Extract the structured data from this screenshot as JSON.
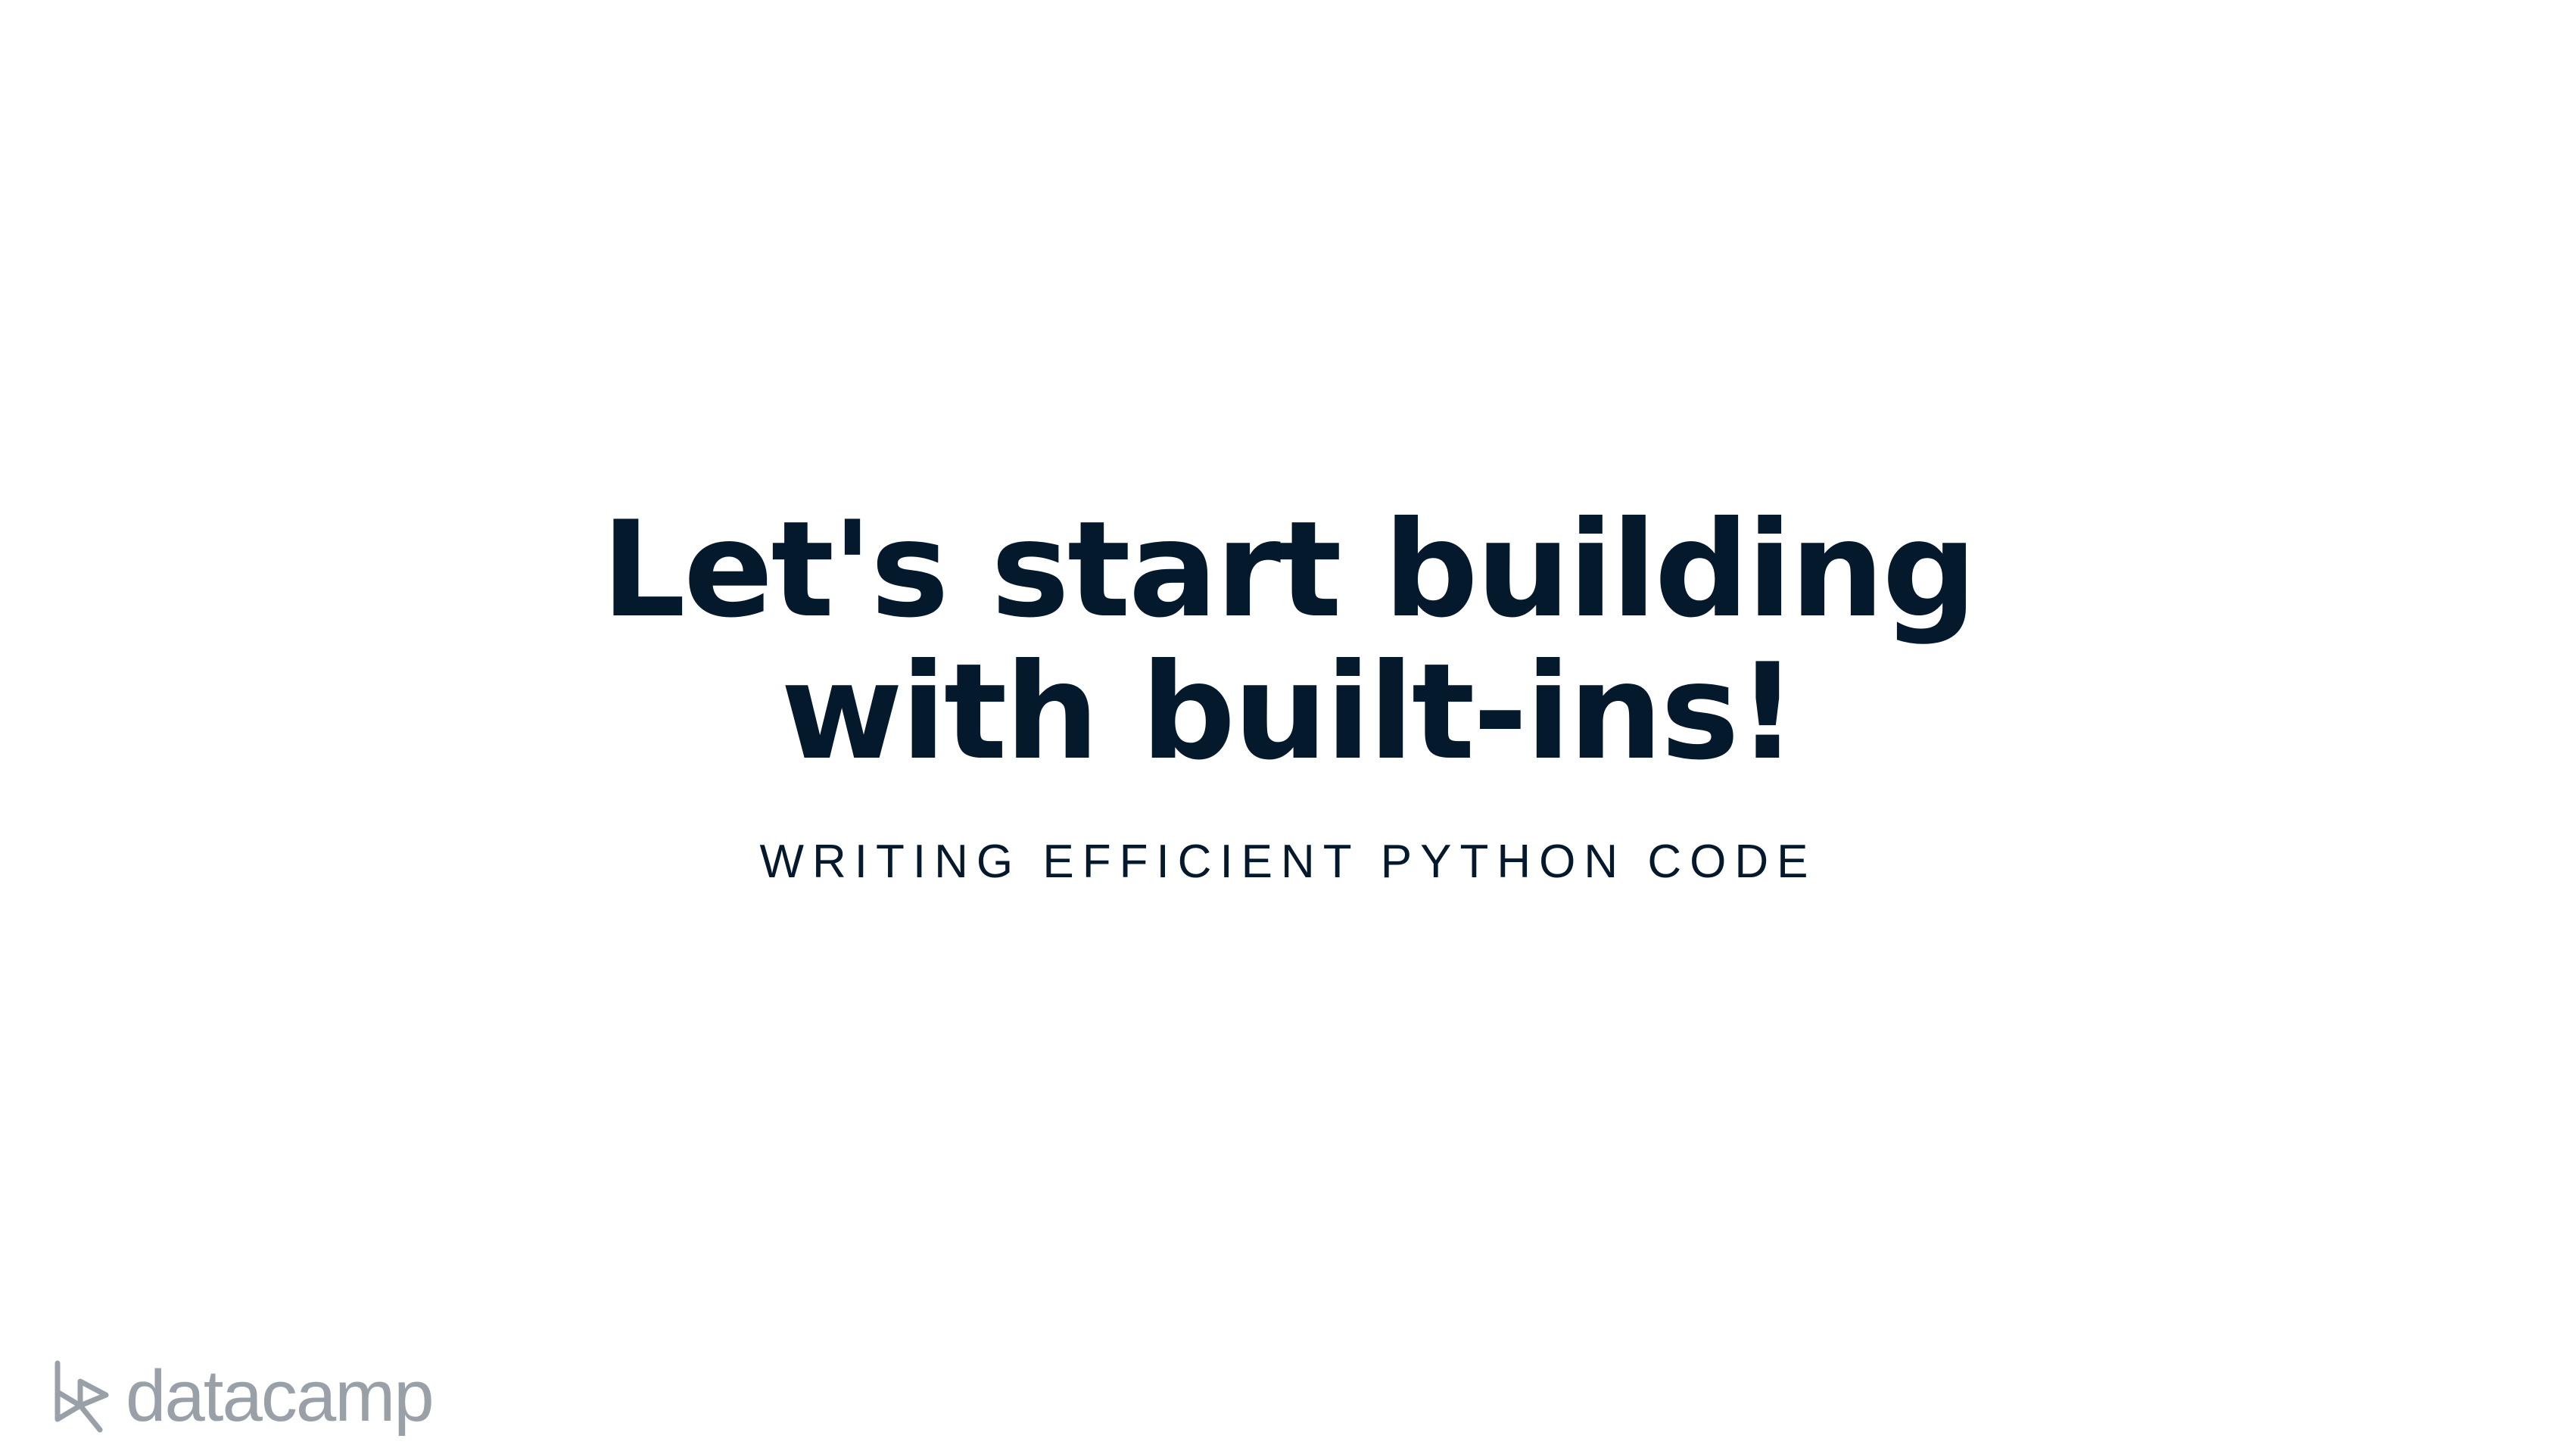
{
  "slide": {
    "title_line1": "Let's start building",
    "title_line2": "with built-ins!",
    "subtitle": "WRITING EFFICIENT PYTHON CODE"
  },
  "brand": {
    "logo_text": "datacamp",
    "logo_icon": "datacamp-logo-icon",
    "logo_color": "#99a0a8",
    "text_color": "#05192d"
  }
}
